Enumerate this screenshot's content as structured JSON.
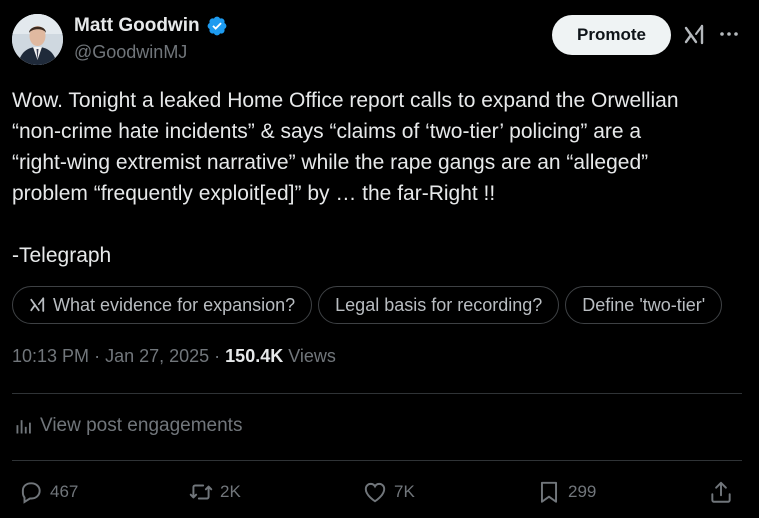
{
  "author": {
    "name": "Matt Goodwin",
    "handle": "@GoodwinMJ"
  },
  "header": {
    "promote_label": "Promote"
  },
  "post": {
    "text": "Wow. Tonight a leaked Home Office report calls to expand the Orwellian\n“non-crime hate incidents” & says “claims of ‘two-tier’ policing” are a\n“right-wing extremist narrative” while the rape gangs are an “alleged”\nproblem “frequently exploit[ed]” by … the far-Right !!\n\n-Telegraph",
    "time": "10:13 PM",
    "date": "Jan 27, 2025",
    "views_count": "150.4K",
    "views_label": "Views"
  },
  "grok_chips": [
    "What evidence for expansion?",
    "Legal basis for recording?",
    "Define 'two-tier'"
  ],
  "engagements_label": "View post engagements",
  "actions": {
    "replies": "467",
    "reposts": "2K",
    "likes": "7K",
    "bookmarks": "299"
  },
  "colors": {
    "background": "#000000",
    "text": "#e7e9ea",
    "muted": "#71767b",
    "verified": "#1d9bf0",
    "promote_bg": "#eff3f4"
  },
  "icons": [
    "verified-badge-icon",
    "grok-icon",
    "more-icon",
    "analytics-icon",
    "reply-icon",
    "repost-icon",
    "like-icon",
    "bookmark-icon",
    "share-icon"
  ]
}
